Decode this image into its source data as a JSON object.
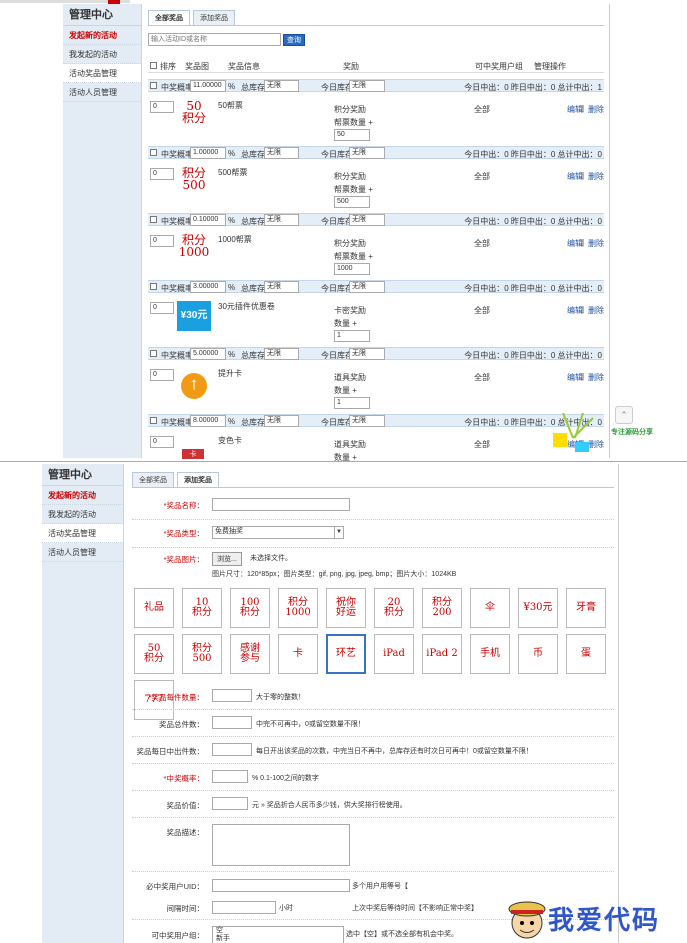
{
  "sidebar": {
    "title": "管理中心",
    "items": [
      "发起新的活动",
      "我发起的活动",
      "活动奖品管理",
      "活动人员管理"
    ]
  },
  "list": {
    "tabs": [
      "全部奖品",
      "添加奖品"
    ],
    "search_placeholder": "输入活动ID或名称",
    "search_btn": "查询",
    "headers": {
      "sort": "排序",
      "img": "奖品图",
      "info": "奖品信息",
      "prize": "奖励",
      "group": "可中奖用户组",
      "ops": "管理操作"
    },
    "labels": {
      "prob": "中奖概率",
      "pct": "%",
      "stock": "总库存",
      "today": "今日库存",
      "edit": "编辑",
      "sep": "|",
      "del": "删除",
      "unlimited": "无限"
    },
    "items": [
      {
        "sort": "0",
        "prob": "11.00000",
        "name": "50帮票",
        "img": [
          "50",
          "积分"
        ],
        "type": "积分奖励",
        "qty_label": "帮票数量 +",
        "qty": "50",
        "group": "全部",
        "stats": "今日中出：0 昨日中出：0 总计中出：1"
      },
      {
        "sort": "0",
        "prob": "1.00000",
        "name": "500帮票",
        "img": [
          "积分",
          "500"
        ],
        "type": "积分奖励",
        "qty_label": "帮票数量 +",
        "qty": "500",
        "group": "全部",
        "stats": "今日中出：0 昨日中出：0 总计中出：0"
      },
      {
        "sort": "0",
        "prob": "0.10000",
        "name": "1000帮票",
        "img": [
          "积分",
          "1000"
        ],
        "type": "积分奖励",
        "qty_label": "帮票数量 +",
        "qty": "1000",
        "group": "全部",
        "stats": "今日中出：0 昨日中出：0 总计中出：0"
      },
      {
        "sort": "0",
        "prob": "3.00000",
        "name": "30元插件优惠卷",
        "img": [
          "¥30元",
          ""
        ],
        "type": "卡密奖励",
        "qty_label": "数量 +",
        "qty": "1",
        "group": "全部",
        "stats": "今日中出：0 昨日中出：0 总计中出：0"
      },
      {
        "sort": "0",
        "prob": "5.00000",
        "name": "提升卡",
        "img": [
          "↑",
          ""
        ],
        "type": "道具奖励",
        "qty_label": "数量 +",
        "qty": "1",
        "group": "全部",
        "stats": "今日中出：0 昨日中出：0 总计中出：0"
      },
      {
        "sort": "0",
        "prob": "8.00000",
        "name": "变色卡",
        "img": [
          "卡",
          ""
        ],
        "type": "道具奖励",
        "qty_label": "数量 +",
        "qty": "",
        "group": "全部",
        "stats": "今日中出：0 昨日中出：0 总计中出：0"
      }
    ]
  },
  "form": {
    "tabs": [
      "全部奖品",
      "添加奖品"
    ],
    "name_label": "*奖品名称：",
    "type_label": "*奖品类型：",
    "type_value": "免费抽奖",
    "img_label": "*奖品图片：",
    "browse": "浏览...",
    "nofile": "未选择文件。",
    "img_hint": "图片尺寸：120*85px；图片类型：gif, png, jpg, jpeg, bmp；图片大小：1024KB",
    "tiles": [
      [
        "礼品",
        ""
      ],
      [
        "10",
        "积分"
      ],
      [
        "100",
        "积分"
      ],
      [
        "积分",
        "1000"
      ],
      [
        "祝你",
        "好运"
      ],
      [
        "20",
        "积分"
      ],
      [
        "积分",
        "200"
      ],
      [
        "伞",
        ""
      ],
      [
        "¥30元",
        ""
      ],
      [
        "牙膏",
        ""
      ],
      [
        "50",
        "积分"
      ],
      [
        "积分",
        "500"
      ],
      [
        "感谢",
        "参与"
      ],
      [
        "卡",
        ""
      ],
      [
        "环艺",
        ""
      ],
      [
        "iPad",
        ""
      ],
      [
        "iPad 2",
        ""
      ],
      [
        "手机",
        ""
      ],
      [
        "币",
        ""
      ],
      [
        "蛋",
        ""
      ],
      [
        "777",
        ""
      ]
    ],
    "fields": [
      {
        "label": "*奖品每件数量：",
        "hint": "大于零的整数！",
        "req": true
      },
      {
        "label": "奖品总件数：",
        "hint": "中完不可再中，0或留空数量不限！",
        "req": false
      },
      {
        "label": "奖品每日中出件数：",
        "hint": "每日开出该奖品的次数，中完当日不再中，总库存还有时次日可再中！0或留空数量不限！",
        "req": false
      },
      {
        "label": "*中奖概率：",
        "hint": "% 0.1-100之间的数字",
        "req": true
      },
      {
        "label": "奖品价值：",
        "hint": "元 » 奖品折合人民币多少钱，供大奖排行榜使用。",
        "req": false
      }
    ],
    "desc_label": "奖品描述：",
    "uid_label": "必中奖用户UID：",
    "uid_hint": "多个用户用等号【",
    "interval_label": "间隔时间：",
    "interval_unit": "小时",
    "interval_hint": "上次中奖后等待时间【不影响正常中奖】",
    "group_label": "可中奖用户组：",
    "group_opts": [
      "空",
      "新手"
    ],
    "group_hint": "选中【空】或不选全部有机会中奖。"
  },
  "watermark": {
    "top": "专注源码分享",
    "bottom": "我爱代码"
  }
}
